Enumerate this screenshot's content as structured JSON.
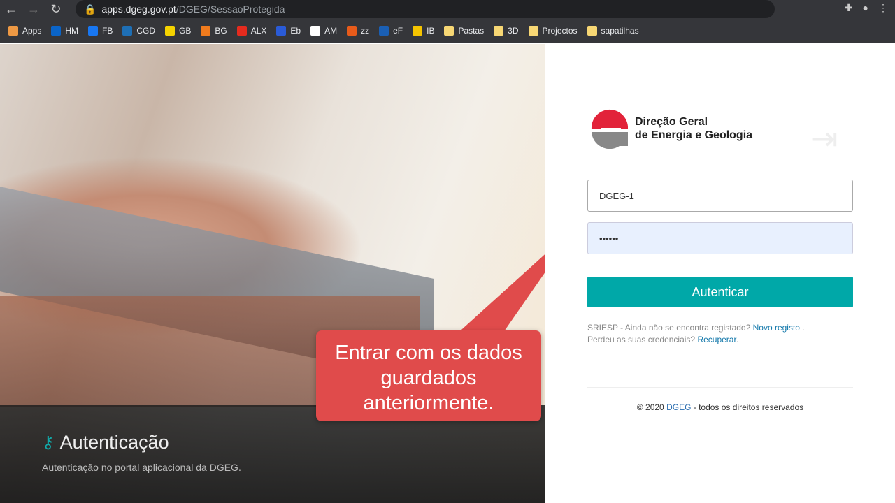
{
  "browser": {
    "url_host": "apps.dgeg.gov.pt",
    "url_path": "/DGEG/SessaoProtegida",
    "bookmarks": [
      {
        "label": "Apps",
        "color": "#e94"
      },
      {
        "label": "HM",
        "color": "#0a64c8"
      },
      {
        "label": "FB",
        "color": "#1877f2"
      },
      {
        "label": "CGD",
        "color": "#1e6fb5"
      },
      {
        "label": "GB",
        "color": "#f5d300"
      },
      {
        "label": "BG",
        "color": "#f07b1d"
      },
      {
        "label": "ALX",
        "color": "#e52b1e"
      },
      {
        "label": "Eb",
        "color": "#2a5bd7"
      },
      {
        "label": "AM",
        "color": "#fff"
      },
      {
        "label": "zz",
        "color": "#e85b1a"
      },
      {
        "label": "eF",
        "color": "#1a5fb4"
      },
      {
        "label": "IB",
        "color": "#f5c400"
      },
      {
        "label": "Pastas",
        "color": "#f7d774"
      },
      {
        "label": "3D",
        "color": "#f7d774"
      },
      {
        "label": "Projectos",
        "color": "#f7d774"
      },
      {
        "label": "sapatilhas",
        "color": "#f7d774"
      }
    ]
  },
  "hero": {
    "title": "Autenticação",
    "subtitle": "Autenticação no portal aplicacional da DGEG.",
    "callout": "Entrar com os dados guardados anteriormente."
  },
  "login": {
    "logo_line1": "Direção Geral",
    "logo_line2": "de Energia e Geologia",
    "username": "DGEG-1",
    "password": "••••••",
    "submit": "Autenticar",
    "register_text": "SRIESP - Ainda não se encontra registado?",
    "register_link": "Novo registo",
    "register_end": " .",
    "recover_text": "Perdeu as suas credenciais?",
    "recover_link": "Recuperar",
    "recover_end": ".",
    "footer_pre": "© 2020 ",
    "footer_link": "DGEG",
    "footer_post": " - todos os direitos reservados"
  },
  "colors": {
    "accent": "#00a8a8",
    "callout": "#e04b4b"
  }
}
